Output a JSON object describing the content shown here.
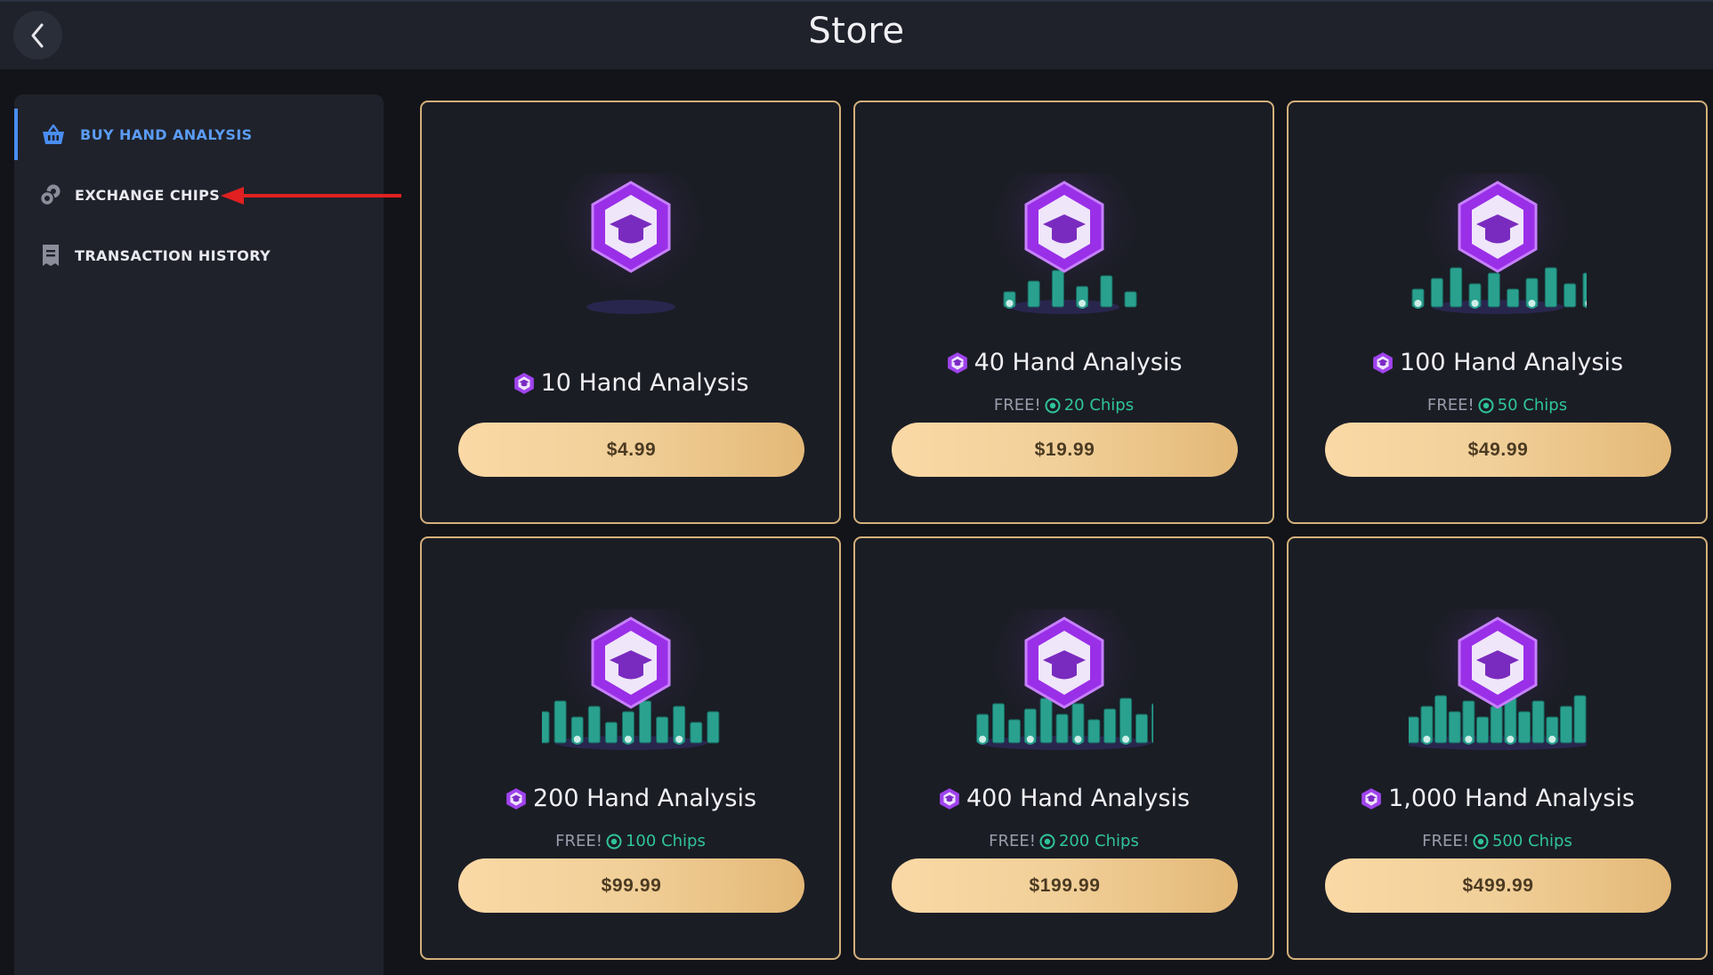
{
  "header": {
    "title": "Store",
    "back_icon": "chevron-left-icon"
  },
  "sidebar": {
    "items": [
      {
        "label": "BUY HAND ANALYSIS",
        "icon": "basket-icon",
        "active": true
      },
      {
        "label": "EXCHANGE CHIPS",
        "icon": "chips-icon",
        "active": false
      },
      {
        "label": "TRANSACTION HISTORY",
        "icon": "receipt-icon",
        "active": false
      }
    ]
  },
  "products": [
    {
      "title": "10 Hand Analysis",
      "free_label": "",
      "bonus": "",
      "price": "$4.99"
    },
    {
      "title": "40 Hand Analysis",
      "free_label": "FREE!",
      "bonus": "20 Chips",
      "price": "$19.99"
    },
    {
      "title": "100 Hand Analysis",
      "free_label": "FREE!",
      "bonus": "50 Chips",
      "price": "$49.99"
    },
    {
      "title": "200 Hand Analysis",
      "free_label": "FREE!",
      "bonus": "100 Chips",
      "price": "$99.99"
    },
    {
      "title": "400 Hand Analysis",
      "free_label": "FREE!",
      "bonus": "200 Chips",
      "price": "$199.99"
    },
    {
      "title": "1,000 Hand Analysis",
      "free_label": "FREE!",
      "bonus": "500 Chips",
      "price": "$499.99"
    }
  ],
  "colors": {
    "accent": "#4a8df2",
    "card_border": "#d3b07a",
    "chips_green": "#2fc49b",
    "badge_purple": "#a43df0",
    "annotation_arrow": "#e02020"
  }
}
